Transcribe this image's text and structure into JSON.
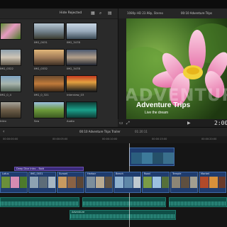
{
  "browser": {
    "title": "Hide Rejected",
    "clips": [
      {
        "label": "",
        "kind": "lotus"
      },
      {
        "label": "IMG_0031",
        "kind": "city"
      },
      {
        "label": "IMG_3478",
        "kind": "boats"
      },
      {
        "label": "IMG_0322",
        "kind": "harbor"
      },
      {
        "label": "IMG_0332",
        "kind": "sunset"
      },
      {
        "label": "IMG_3478",
        "kind": "dusk"
      },
      {
        "label": "IMG_0_4",
        "kind": "shore"
      },
      {
        "label": "IMG_0_321",
        "kind": "building"
      },
      {
        "label": "Interview_03",
        "kind": "neon"
      },
      {
        "label": "Intro",
        "kind": "temple"
      },
      {
        "label": "Sea",
        "kind": "road"
      },
      {
        "label": "Audio",
        "kind": "audio"
      }
    ]
  },
  "viewer": {
    "format": "1080p HD 23.98p, Stereo",
    "project": "00:10 Adventure Trips",
    "title_main": "Adventure Trips",
    "title_sub": "Live the dream",
    "watermark": "ADVENTURE",
    "timecode": "2:00"
  },
  "timeline": {
    "project_label": "00:10 Adventure Trips Trailer",
    "duration": "01:20:11",
    "ruler": [
      "00:00:00:00",
      "00:00:05:00",
      "00:00:10:00",
      "00:00:15:00",
      "00:00:20:00"
    ],
    "title_clip": "Deep Dive Intro – Bold",
    "clips": [
      "Lotus",
      "IMG_0031",
      "Sunset",
      "Harbor",
      "Beach",
      "Road",
      "Temple",
      "Market"
    ],
    "audio_label": "Adventure"
  },
  "colors": {
    "accent": "#f0a5c8",
    "clip": "#1f3c6e",
    "audio": "#0f4f47",
    "title": "#3a2a7a"
  }
}
